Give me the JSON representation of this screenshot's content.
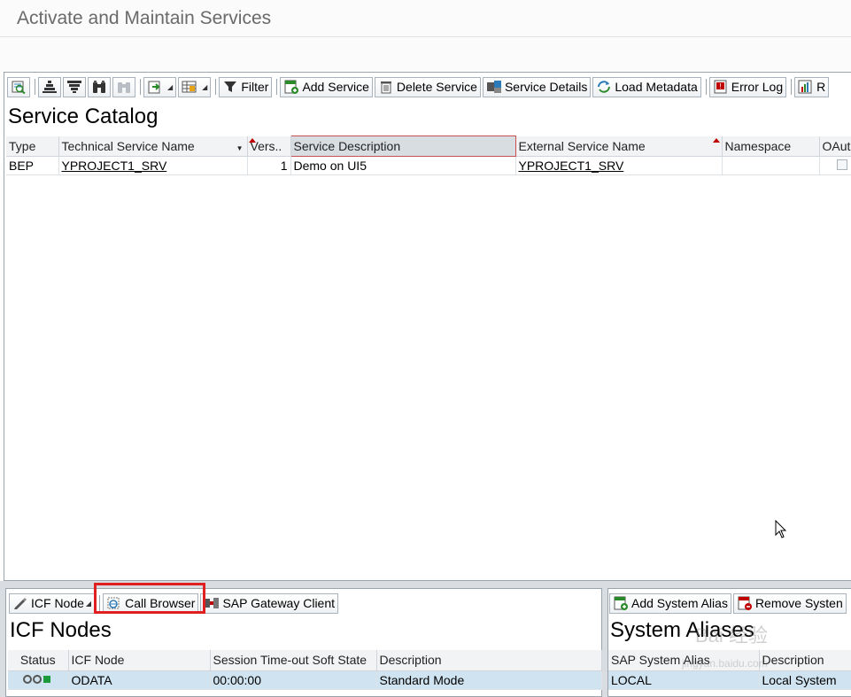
{
  "window": {
    "title": "Activate and Maintain Services"
  },
  "catalog_toolbar": {
    "filter": "Filter",
    "add_service": "Add Service",
    "delete_service": "Delete Service",
    "service_details": "Service Details",
    "load_metadata": "Load Metadata",
    "error_log": "Error Log",
    "overflow": "R"
  },
  "service_catalog": {
    "title": "Service Catalog",
    "columns": [
      "Type",
      "Technical Service Name",
      "Vers..",
      "Service Description",
      "External Service Name",
      "Namespace",
      "OAut"
    ],
    "rows": [
      {
        "type": "BEP",
        "technical_name": "YPROJECT1_SRV",
        "version": "1",
        "description": "Demo on UI5",
        "external_name": "YPROJECT1_SRV",
        "namespace": ""
      }
    ]
  },
  "icf_toolbar": {
    "icf_node": "ICF Node",
    "call_browser": "Call Browser",
    "gateway_client": "SAP Gateway Client"
  },
  "icf_nodes": {
    "title": "ICF Nodes",
    "columns": [
      "Status",
      "ICF Node",
      "Session Time-out Soft State",
      "Description"
    ],
    "rows": [
      {
        "node": "ODATA",
        "timeout": "00:00:00",
        "description": "Standard Mode"
      }
    ]
  },
  "alias_toolbar": {
    "add_alias": "Add System Alias",
    "remove_alias": "Remove Systen"
  },
  "system_aliases": {
    "title": "System Aliases",
    "columns": [
      "SAP System Alias",
      "Description"
    ],
    "rows": [
      {
        "alias": "LOCAL",
        "description": "Local System"
      }
    ]
  },
  "watermark": {
    "text": "Bai 经验",
    "sub": "jingyan.baidu.com"
  },
  "colors": {
    "highlight_box": "#e02020",
    "selected_cell": "#cfe3f0",
    "status_green": "#1a9a3a"
  }
}
